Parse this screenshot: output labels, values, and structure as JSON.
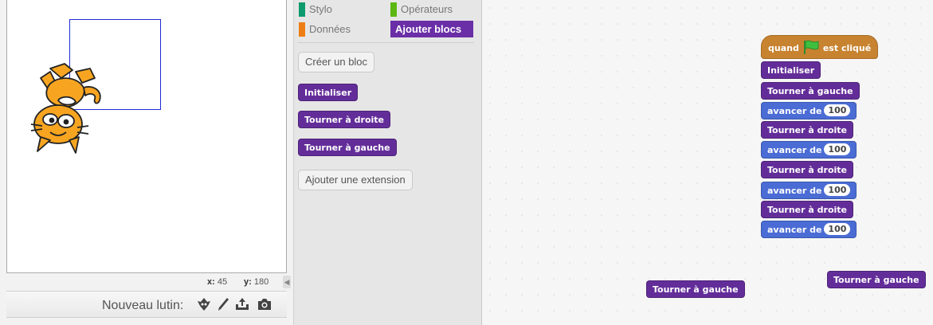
{
  "stage": {
    "coords": {
      "x_label": "x:",
      "x_value": "45",
      "y_label": "y:",
      "y_value": "180"
    },
    "new_sprite_label": "Nouveau lutin:",
    "icons": [
      "sprite-library-icon",
      "paint-brush-icon",
      "upload-icon",
      "camera-icon"
    ]
  },
  "palette": {
    "categories": [
      {
        "label": "Stylo",
        "color": "#0e9a6c"
      },
      {
        "label": "Opérateurs",
        "color": "#5cb712"
      },
      {
        "label": "Données",
        "color": "#ee7d16"
      },
      {
        "label": "Ajouter blocs",
        "color": "#632d99",
        "selected": true
      }
    ],
    "make_block": "Créer un bloc",
    "blocks": [
      "Initialiser",
      "Tourner à droite",
      "Tourner à gauche"
    ],
    "add_extension": "Ajouter une extension"
  },
  "script": {
    "hat": {
      "pre": "quand",
      "post": "est cliqué",
      "icon": "green-flag-icon"
    },
    "blocks": [
      {
        "label": "Initialiser",
        "kind": "custom"
      },
      {
        "label": "Tourner à gauche",
        "kind": "custom"
      },
      {
        "label": "avancer de",
        "kind": "motion",
        "value": "100"
      },
      {
        "label": "Tourner à droite",
        "kind": "custom"
      },
      {
        "label": "avancer de",
        "kind": "motion",
        "value": "100"
      },
      {
        "label": "Tourner à droite",
        "kind": "custom"
      },
      {
        "label": "avancer de",
        "kind": "motion",
        "value": "100"
      },
      {
        "label": "Tourner à droite",
        "kind": "custom"
      },
      {
        "label": "avancer de",
        "kind": "motion",
        "value": "100"
      }
    ],
    "loose_blocks": [
      "Tourner à gauche",
      "Tourner à gauche"
    ]
  },
  "colors": {
    "custom_block": "#632d99",
    "motion_block": "#4a6cd4",
    "event_block": "#c88330",
    "pen_line": "#1e2ad6"
  }
}
